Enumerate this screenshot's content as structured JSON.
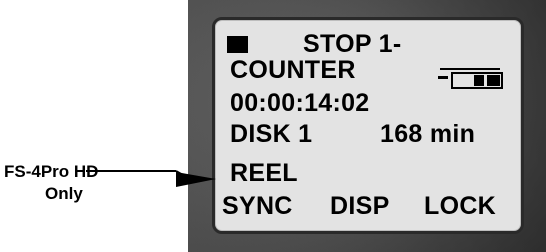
{
  "display": {
    "status": "STOP 1-",
    "mode": "COUNTER",
    "timecode": "00:00:14:02",
    "disk_label": "DISK 1",
    "disk_remaining": "168 min",
    "reel": "REEL",
    "softkeys": [
      "SYNC",
      "DISP",
      "LOCK"
    ],
    "icons": {
      "stop": "stop-square-icon",
      "battery": "battery-icon"
    }
  },
  "callout": {
    "line1": "FS-4Pro HD",
    "line2": "Only"
  },
  "colors": {
    "lcd_background": "#e3e3e3",
    "lcd_text": "#000000",
    "bezel": "#505050"
  }
}
